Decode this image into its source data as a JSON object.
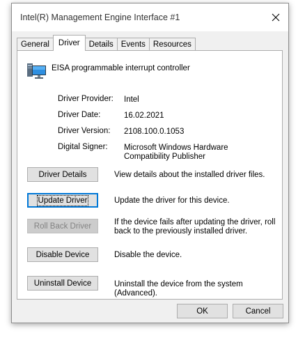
{
  "window": {
    "title": "Intel(R) Management Engine Interface #1"
  },
  "tabs": [
    {
      "label": "General"
    },
    {
      "label": "Driver"
    },
    {
      "label": "Details"
    },
    {
      "label": "Events"
    },
    {
      "label": "Resources"
    }
  ],
  "active_tab": "Driver",
  "device": {
    "name": "EISA programmable interrupt controller",
    "icon": "computer-monitor-icon"
  },
  "info": {
    "provider_label": "Driver Provider:",
    "provider_value": "Intel",
    "date_label": "Driver Date:",
    "date_value": "16.02.2021",
    "version_label": "Driver Version:",
    "version_value": "2108.100.0.1053",
    "signer_label": "Digital Signer:",
    "signer_value_line1": "Microsoft Windows Hardware",
    "signer_value_line2": "Compatibility Publisher"
  },
  "actions": {
    "details_label": "Driver Details",
    "details_desc": "View details about the installed driver files.",
    "update_label": "Update Driver",
    "update_desc": "Update the driver for this device.",
    "rollback_label": "Roll Back Driver",
    "rollback_desc_line1": "If the device fails after updating the driver, roll",
    "rollback_desc_line2": "back to the previously installed driver.",
    "disable_label": "Disable Device",
    "disable_desc": "Disable the device.",
    "uninstall_label": "Uninstall Device",
    "uninstall_desc": "Uninstall the device from the system (Advanced)."
  },
  "footer": {
    "ok_label": "OK",
    "cancel_label": "Cancel"
  },
  "colors": {
    "focus_border": "#0078d7",
    "window_bg": "#f0f0f0",
    "panel_bg": "#ffffff"
  }
}
